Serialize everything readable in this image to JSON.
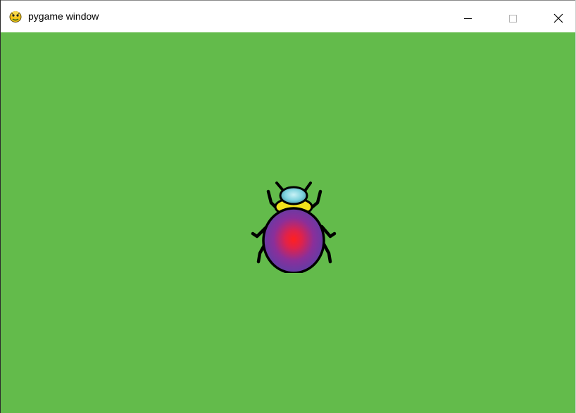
{
  "window": {
    "title": "pygame window",
    "app_icon": "pygame-snake-icon",
    "controls": {
      "minimize": "minimize-icon",
      "maximize": "maximize-icon",
      "close": "close-icon"
    }
  },
  "scene": {
    "background_color": "#63bb4b",
    "sprite": {
      "name": "beetle",
      "colors": {
        "body_center": "#ff2020",
        "body_edge": "#5b3fa8",
        "head": "#7fd3de",
        "thorax": "#f2e21b",
        "outline": "#000000"
      }
    }
  }
}
